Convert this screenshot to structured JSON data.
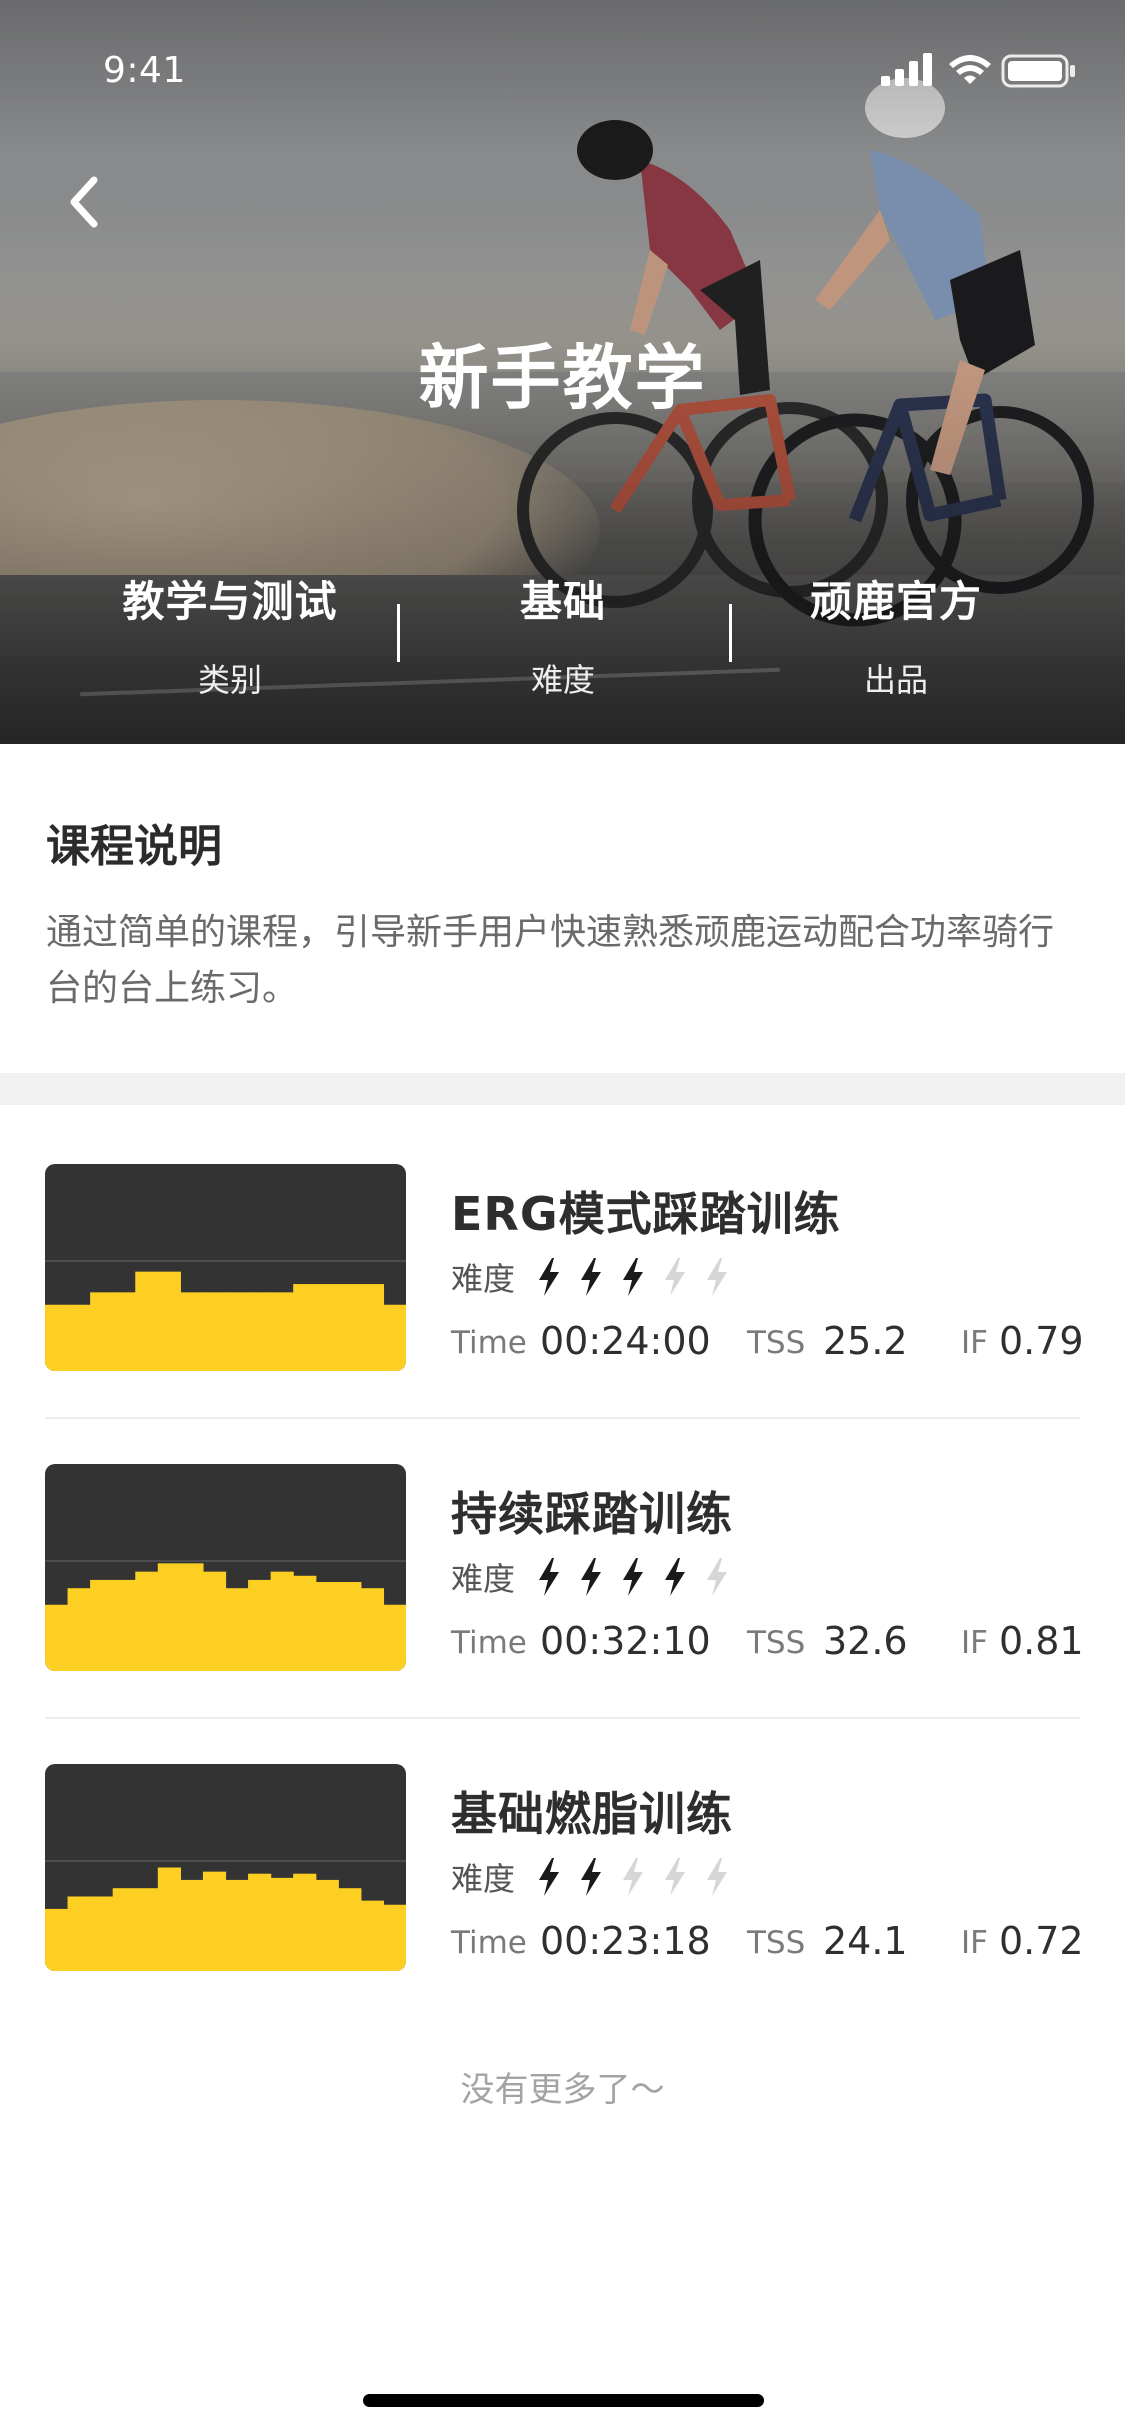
{
  "status_bar": {
    "time": "9:41"
  },
  "header": {
    "title": "新手教学",
    "meta": [
      {
        "value": "教学与测试",
        "label": "类别"
      },
      {
        "value": "基础",
        "label": "难度"
      },
      {
        "value": "顽鹿官方",
        "label": "出品"
      }
    ]
  },
  "description": {
    "title": "课程说明",
    "body": "通过简单的课程，引导新手用户快速熟悉顽鹿运动配合功率骑行台的台上练习。"
  },
  "courses": [
    {
      "title": "ERG模式踩踏训练",
      "difficulty_label": "难度",
      "difficulty": 3,
      "difficulty_max": 5,
      "time_label": "Time",
      "time": "00:24:00",
      "tss_label": "TSS",
      "tss": "25.2",
      "if_label": "IF",
      "if": "0.79",
      "profile": [
        0.32,
        0.32,
        0.38,
        0.38,
        0.48,
        0.48,
        0.38,
        0.38,
        0.38,
        0.38,
        0.38,
        0.42,
        0.42,
        0.42,
        0.42,
        0.32
      ]
    },
    {
      "title": "持续踩踏训练",
      "difficulty_label": "难度",
      "difficulty": 4,
      "difficulty_max": 5,
      "time_label": "Time",
      "time": "00:32:10",
      "tss_label": "TSS",
      "tss": "32.6",
      "if_label": "IF",
      "if": "0.81",
      "profile": [
        0.32,
        0.4,
        0.44,
        0.44,
        0.48,
        0.52,
        0.52,
        0.48,
        0.4,
        0.44,
        0.48,
        0.46,
        0.43,
        0.43,
        0.4,
        0.32
      ]
    },
    {
      "title": "基础燃脂训练",
      "difficulty_label": "难度",
      "difficulty": 2,
      "difficulty_max": 5,
      "time_label": "Time",
      "time": "00:23:18",
      "tss_label": "TSS",
      "tss": "24.1",
      "if_label": "IF",
      "if": "0.72",
      "profile": [
        0.3,
        0.36,
        0.36,
        0.4,
        0.4,
        0.5,
        0.44,
        0.48,
        0.44,
        0.47,
        0.45,
        0.47,
        0.44,
        0.4,
        0.34,
        0.32
      ]
    }
  ],
  "footer": {
    "no_more": "没有更多了～"
  },
  "colors": {
    "accent_yellow": "#FCCF22",
    "thumb_bg": "#333334",
    "bolt_active": "#1a1a1a",
    "bolt_inactive": "#d6d6d6"
  }
}
